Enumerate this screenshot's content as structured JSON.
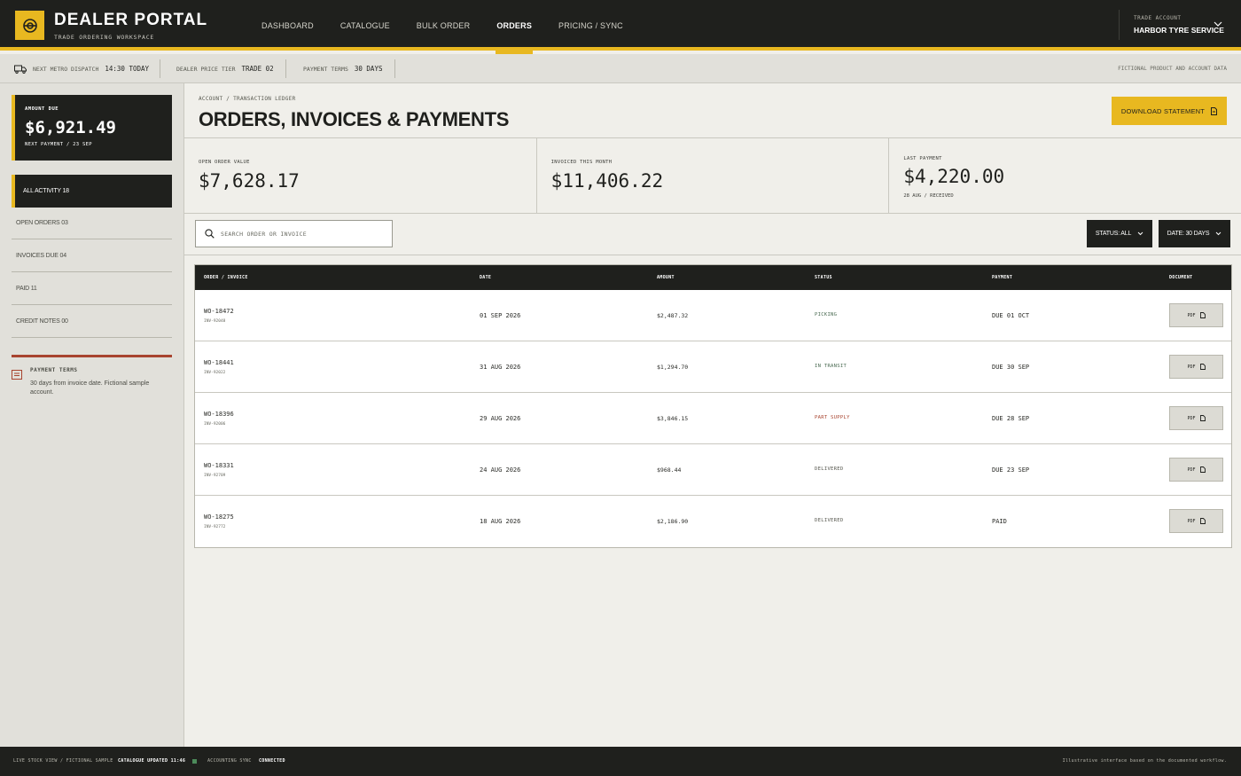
{
  "brand": {
    "title": "DEALER PORTAL",
    "subtitle": "TRADE ORDERING WORKSPACE",
    "logo_icon": "tyre-icon"
  },
  "nav": [
    {
      "label": "DASHBOARD",
      "active": false
    },
    {
      "label": "CATALOGUE",
      "active": false
    },
    {
      "label": "BULK ORDER",
      "active": false
    },
    {
      "label": "ORDERS",
      "active": true
    },
    {
      "label": "PRICING / SYNC",
      "active": false
    }
  ],
  "account": {
    "label": "TRADE ACCOUNT",
    "name": "HARBOR TYRE SERVICE"
  },
  "strip": {
    "dispatch_label": "NEXT METRO DISPATCH",
    "dispatch_value": "14:30 TODAY",
    "tier_label": "DEALER PRICE TIER",
    "tier_value": "TRADE 02",
    "terms_label": "PAYMENT TERMS",
    "terms_value": "30 DAYS",
    "notice": "FICTIONAL PRODUCT AND ACCOUNT DATA"
  },
  "sidebar": {
    "amount_due_label": "AMOUNT DUE",
    "amount_due": "$6,921.49",
    "next_payment": "NEXT PAYMENT / 23 SEP",
    "filters": [
      {
        "label": "ALL ACTIVITY 18",
        "active": true
      },
      {
        "label": "OPEN ORDERS 03",
        "active": false
      },
      {
        "label": "INVOICES DUE 04",
        "active": false
      },
      {
        "label": "PAID 11",
        "active": false
      },
      {
        "label": "CREDIT NOTES 00",
        "active": false
      }
    ],
    "terms_title": "PAYMENT TERMS",
    "terms_text": "30 days from invoice date. Fictional sample account."
  },
  "header": {
    "breadcrumb": "ACCOUNT / TRANSACTION LEDGER",
    "title": "ORDERS, INVOICES & PAYMENTS",
    "download_label": "DOWNLOAD STATEMENT"
  },
  "metrics": [
    {
      "label": "OPEN ORDER VALUE",
      "value": "$7,628.17",
      "note": ""
    },
    {
      "label": "INVOICED THIS MONTH",
      "value": "$11,406.22",
      "note": ""
    },
    {
      "label": "LAST PAYMENT",
      "value": "$4,220.00",
      "note": "28 AUG / RECEIVED"
    }
  ],
  "toolbar": {
    "search_placeholder": "SEARCH ORDER OR INVOICE",
    "status_filter": "STATUS: ALL",
    "date_filter": "DATE: 30 DAYS"
  },
  "table": {
    "columns": [
      "ORDER / INVOICE",
      "DATE",
      "AMOUNT",
      "STATUS",
      "PAYMENT",
      "DOCUMENT"
    ],
    "rows": [
      {
        "order": "WO-18472",
        "invoice": "INV-92048",
        "date": "01 SEP 2026",
        "amount": "$2,487.32",
        "status": "PICKING",
        "payment": "DUE 01 OCT",
        "doc": "PDF"
      },
      {
        "order": "WO-18441",
        "invoice": "INV-92022",
        "date": "31 AUG 2026",
        "amount": "$1,294.70",
        "status": "IN TRANSIT",
        "payment": "DUE 30 SEP",
        "doc": "PDF"
      },
      {
        "order": "WO-18396",
        "invoice": "INV-92006",
        "date": "29 AUG 2026",
        "amount": "$3,846.15",
        "status": "PART SUPPLY",
        "payment": "DUE 28 SEP",
        "doc": "PDF"
      },
      {
        "order": "WO-18331",
        "invoice": "INV-92709",
        "date": "24 AUG 2026",
        "amount": "$968.44",
        "status": "DELIVERED",
        "payment": "DUE 23 SEP",
        "doc": "PDF"
      },
      {
        "order": "WO-18275",
        "invoice": "INV-92772",
        "date": "18 AUG 2026",
        "amount": "$2,186.90",
        "status": "DELIVERED",
        "payment": "PAID",
        "doc": "PDF"
      }
    ]
  },
  "status_colors": {
    "PICKING": "#4a6b52",
    "IN TRANSIT": "#4a6b52",
    "PART SUPPLY": "#a8442f",
    "DELIVERED": "#57584f"
  },
  "footer": {
    "live": "LIVE STOCK VIEW / FICTIONAL SAMPLE",
    "catalogue": "CATALOGUE UPDATED 11:46",
    "sync_label": "ACCOUNTING SYNC",
    "sync_value": "CONNECTED",
    "note": "Illustrative interface based on the documented workflow."
  },
  "colors": {
    "accent": "#e8b820",
    "dark": "#1f201d",
    "alert": "#a8442f"
  }
}
